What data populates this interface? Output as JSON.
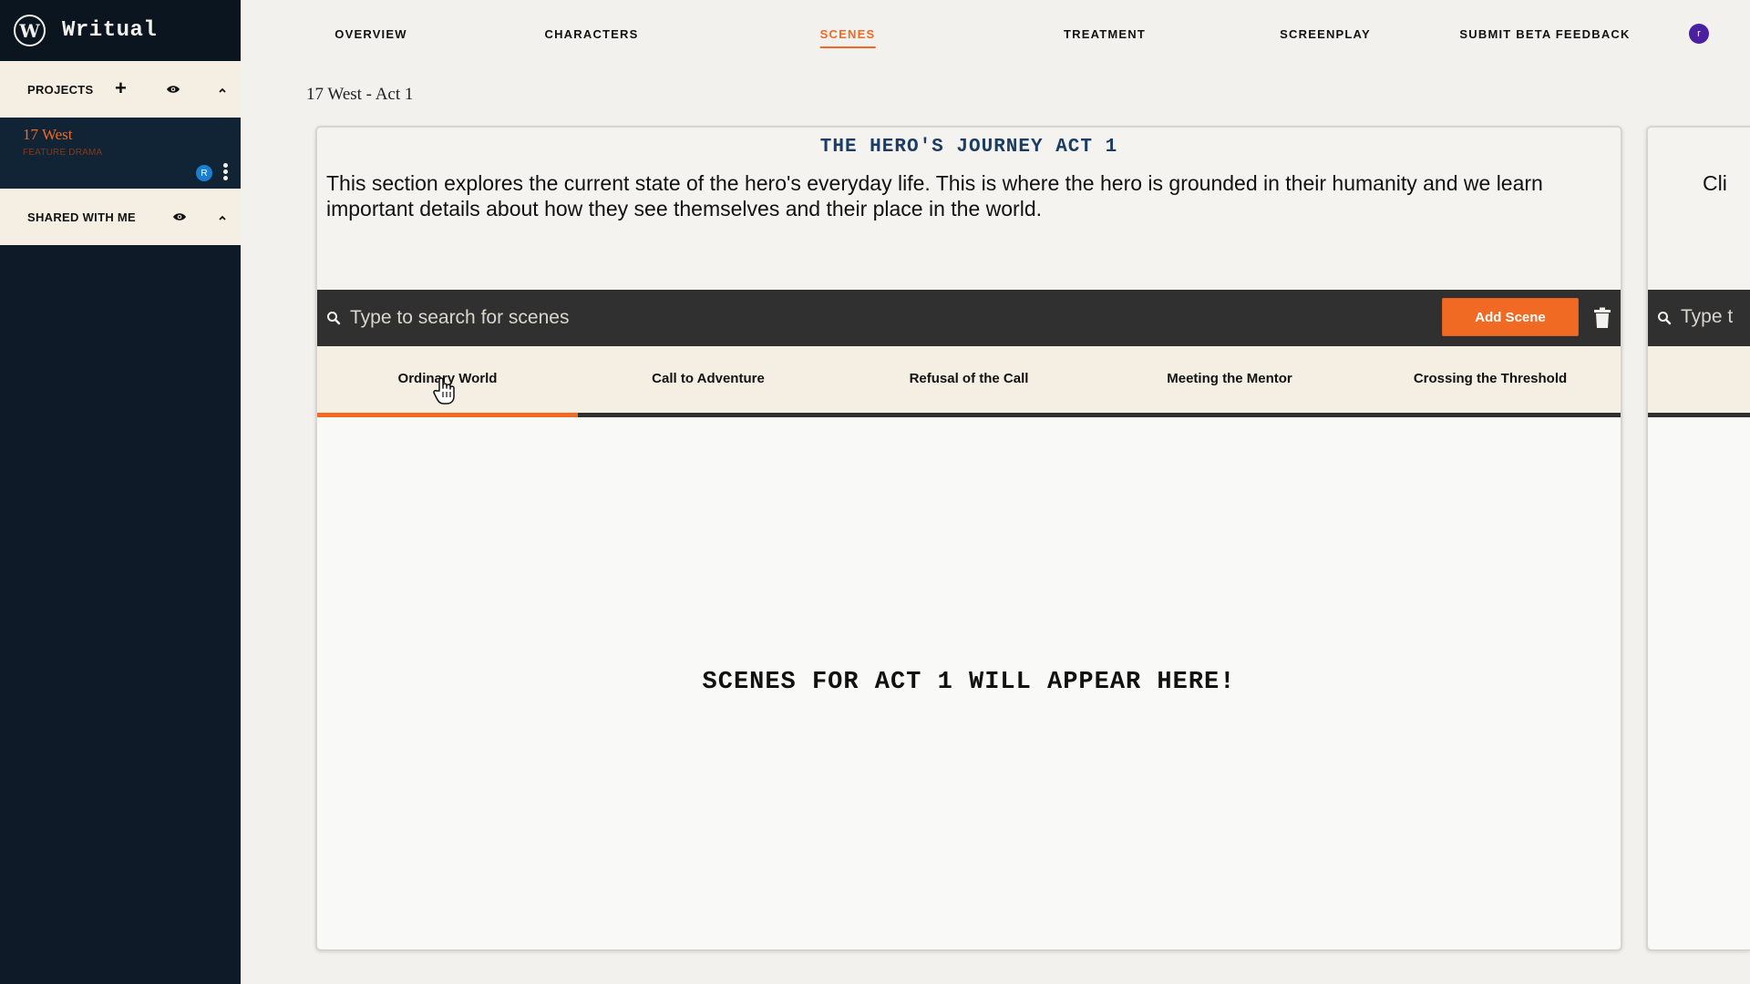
{
  "app": {
    "name": "Writual",
    "logo_letter": "W"
  },
  "sidebar": {
    "projects_label": "PROJECTS",
    "add_label": "+",
    "project": {
      "title": "17 West",
      "subtitle": "FEATURE DRAMA",
      "collaborator_initial": "R"
    },
    "shared_label": "SHARED WITH ME"
  },
  "nav": {
    "items": [
      "OVERVIEW",
      "CHARACTERS",
      "SCENES",
      "TREATMENT",
      "SCREENPLAY",
      "SUBMIT BETA FEEDBACK"
    ],
    "active": "SCENES",
    "user_initial": "r"
  },
  "page": {
    "title": "17 West - Act 1"
  },
  "act_card": {
    "title": "THE HERO'S JOURNEY ACT 1",
    "description": "This section explores the current state of the hero's everyday life. This is where the hero is grounded in their humanity and we learn important details about how they see themselves and their place in the world.",
    "search_placeholder": "Type to search for scenes",
    "add_button": "Add Scene",
    "tabs": [
      "Ordinary World",
      "Call to Adventure",
      "Refusal of the Call",
      "Meeting the Mentor",
      "Crossing the Threshold"
    ],
    "active_tab": "Ordinary World",
    "empty_message": "SCENES FOR ACT 1 WILL APPEAR HERE!"
  },
  "next_card": {
    "heading_fragment": "Cli",
    "search_fragment": "Type t"
  },
  "colors": {
    "accent": "#f06a23",
    "sidebar_bg": "#0e1a27",
    "title_blue": "#1b3c63",
    "dark_bar": "#2f302f"
  },
  "icons": [
    "plus-icon",
    "eye-icon",
    "chevron-up-icon",
    "kebab-icon",
    "search-icon",
    "trash-icon",
    "hand-cursor-icon"
  ]
}
